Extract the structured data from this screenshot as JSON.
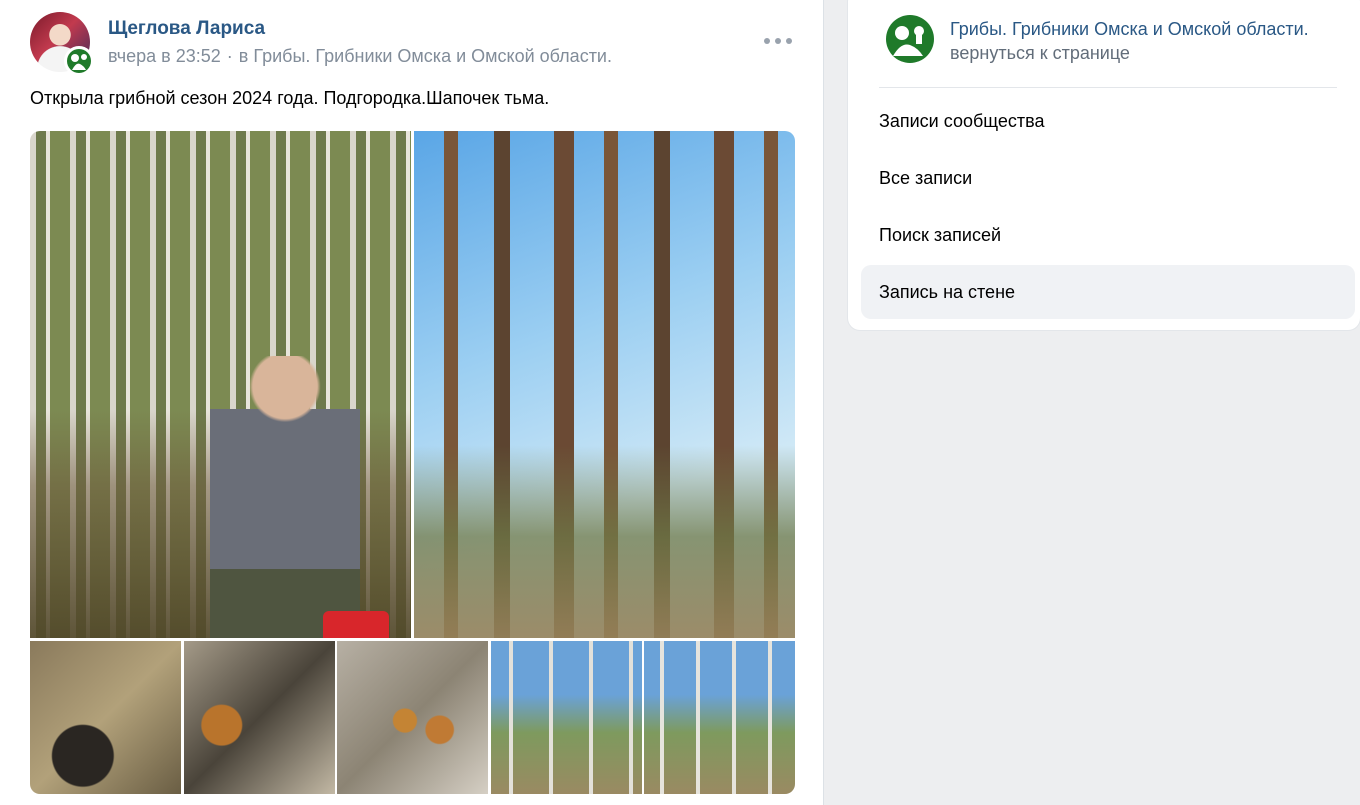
{
  "post": {
    "author": "Щеглова Лариса",
    "time": "вчера в 23:52",
    "separator": "·",
    "community_ref": "в Грибы. Грибники Омска и Омской области.",
    "text": "Открыла грибной сезон 2024 года. Подгородка.Шапочек тьма."
  },
  "sidebar": {
    "group_name": "Грибы. Грибники Омска и Омской области.",
    "back_link": "вернуться к странице",
    "menu": [
      {
        "label": "Записи сообщества",
        "active": false
      },
      {
        "label": "Все записи",
        "active": false
      },
      {
        "label": "Поиск записей",
        "active": false
      },
      {
        "label": "Запись на стене",
        "active": true
      }
    ]
  },
  "colors": {
    "link": "#2a5885",
    "meta": "#818c99",
    "logo_green": "#1f7a2a",
    "page_bg": "#edeef0"
  },
  "icons": {
    "more": "more-horizontal-icon",
    "group_logo": "mushroom-picker-logo"
  }
}
